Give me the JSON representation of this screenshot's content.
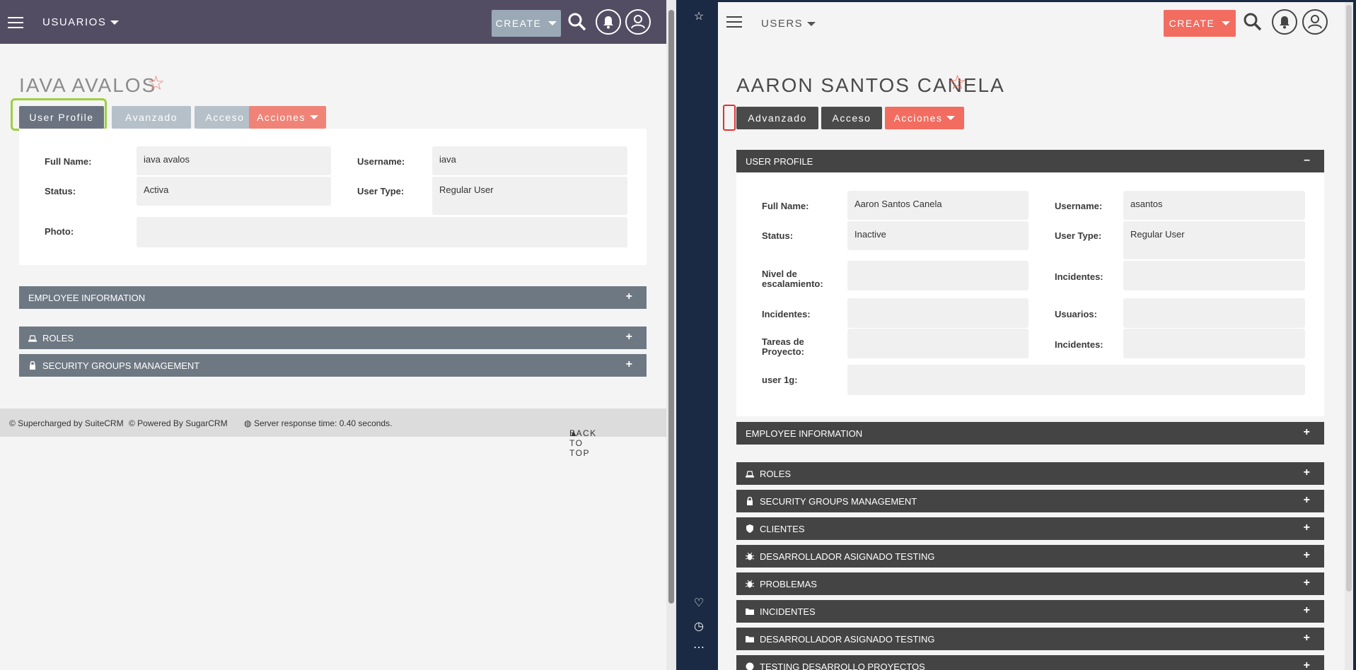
{
  "left": {
    "module_title": "USUARIOS",
    "create_label": "CREATE",
    "user_name": "IAVA AVALOS",
    "tabs": [
      "User Profile",
      "Avanzado",
      "Acceso",
      "Acciones"
    ],
    "fields": {
      "full_name_label": "Full Name:",
      "full_name_value": "iava avalos",
      "username_label": "Username:",
      "username_value": "iava",
      "status_label": "Status:",
      "status_value": "Activa",
      "user_type_label": "User Type:",
      "user_type_value": "Regular User",
      "photo_label": "Photo:"
    },
    "sections": [
      "EMPLOYEE INFORMATION",
      "ROLES",
      "SECURITY GROUPS MANAGEMENT"
    ],
    "footer": {
      "supercharged": "© Supercharged by SuiteCRM",
      "powered": "© Powered By SugarCRM",
      "response": "Server response time: 0.40 seconds.",
      "back_to_top": "BACK TO TOP"
    }
  },
  "right": {
    "module_title": "USERS",
    "create_label": "CREATE",
    "user_name": "AARON SANTOS CANELA",
    "tabs": [
      "Advanzado",
      "Acceso",
      "Acciones"
    ],
    "profile_header": "USER PROFILE",
    "profile_toggle": "–",
    "fields": {
      "full_name_label": "Full Name:",
      "full_name_value": "Aaron Santos Canela",
      "username_label": "Username:",
      "username_value": "asantos",
      "status_label": "Status:",
      "status_value": "Inactive",
      "user_type_label": "User Type:",
      "user_type_value": "Regular User",
      "nivel_label": "Nivel de escalamiento:",
      "incidentes_label_1": "Incidentes:",
      "incidentes_label_2": "Incidentes:",
      "usuarios_label": "Usuarios:",
      "tareas_label": "Tareas de Proyecto:",
      "incidentes_label_3": "Incidentes:",
      "user1g_label": "user 1g:"
    },
    "sections": [
      {
        "label": "EMPLOYEE INFORMATION",
        "icon": "none"
      },
      {
        "label": "ROLES",
        "icon": "roles-icon"
      },
      {
        "label": "SECURITY GROUPS MANAGEMENT",
        "icon": "lock-icon"
      },
      {
        "label": "CLIENTES",
        "icon": "shield-icon"
      },
      {
        "label": "DESARROLLADOR ASIGNADO TESTING",
        "icon": "bug-icon"
      },
      {
        "label": "PROBLEMAS",
        "icon": "bug-icon"
      },
      {
        "label": "INCIDENTES",
        "icon": "folder-icon"
      },
      {
        "label": "DESARROLLADOR ASIGNADO TESTING",
        "icon": "folder-icon"
      },
      {
        "label": "TESTING DESARROLLO PROYECTOS",
        "icon": "pie-icon"
      }
    ]
  },
  "colors": {
    "left_topbar": "#534d64",
    "left_create": "#9aa9b5",
    "tab_active_left": "#6b7381",
    "tab_inactive_left": "#b5c0c9",
    "acciones": "#f08377",
    "section_left": "#6d7883",
    "right_dark": "#444444",
    "right_create": "#f26c60",
    "highlight_green": "#9ed03d",
    "highlight_red": "#e03030"
  }
}
